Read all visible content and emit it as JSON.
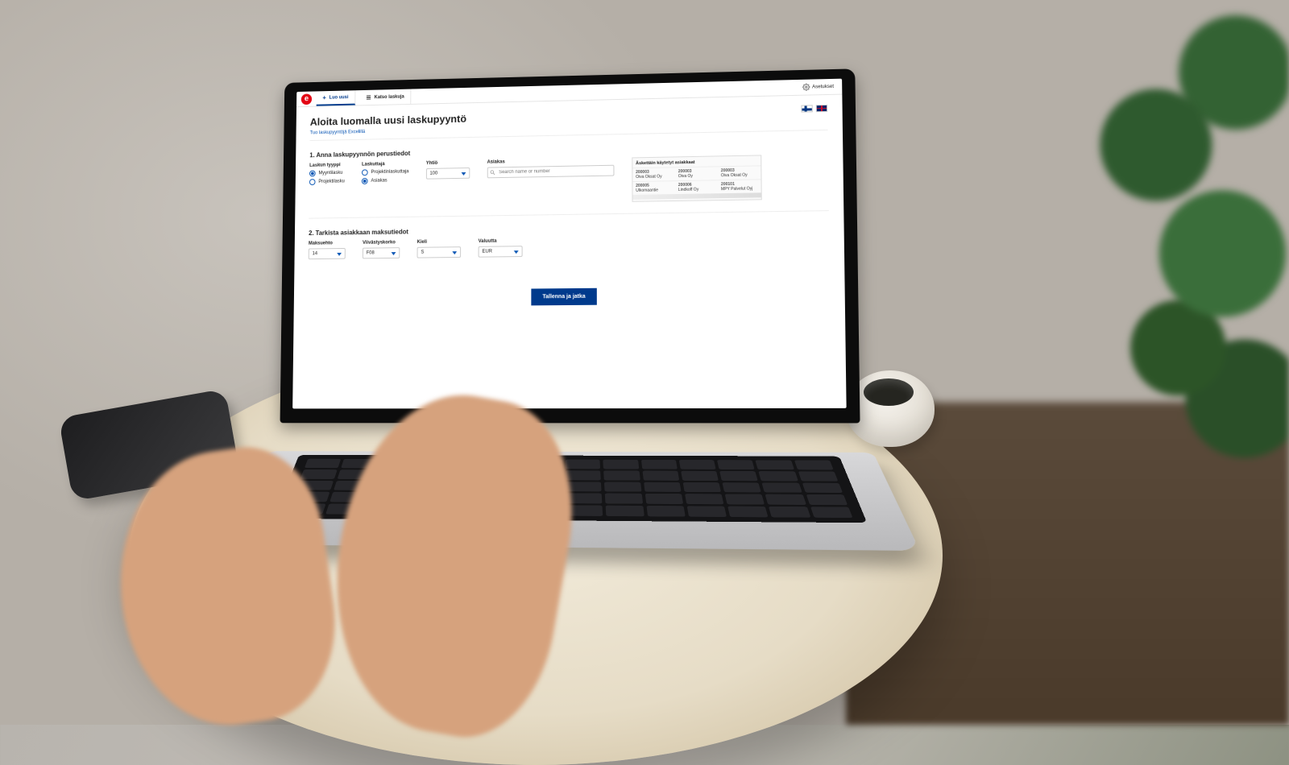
{
  "topbar": {
    "logo_letter": "e",
    "tabs": [
      {
        "icon": "+",
        "label": "Luo uusi",
        "active": true
      },
      {
        "icon": "≣",
        "label": "Katso laskuja",
        "active": false
      }
    ],
    "settings_label": "Asetukset"
  },
  "page": {
    "title": "Aloita luomalla uusi laskupyyntö",
    "subtitle_link": "Tuo laskupyyntöjä Excelillä"
  },
  "section1": {
    "title": "1. Anna laskupyynnön perustiedot",
    "invoice_type": {
      "label": "Laskun tyyppi",
      "options": [
        {
          "label": "Myyntilasku",
          "checked": true
        },
        {
          "label": "Projektilasku",
          "checked": false
        }
      ]
    },
    "invoicer": {
      "label": "Laskuttaja",
      "options": [
        {
          "label": "Projektinlaskuttaja",
          "checked": false
        },
        {
          "label": "Asiakas",
          "checked": true
        }
      ]
    },
    "company": {
      "label": "Yhtiö",
      "value": "100"
    },
    "customer": {
      "label": "Asiakas",
      "search_placeholder": "Search name or number",
      "panel_title": "Äskettäin käytetyt asiakkaat",
      "recent": [
        {
          "id": "200003",
          "name": "Oiva Oksat Oy"
        },
        {
          "id": "200003",
          "name": "Oiva Oy"
        },
        {
          "id": "200003",
          "name": "Oiva Oksat Oy"
        },
        {
          "id": "200005",
          "name": "Ulkomaantie"
        },
        {
          "id": "200006",
          "name": "Lindkoff Oy"
        },
        {
          "id": "200101",
          "name": "MPY Palvelut Oyj"
        }
      ]
    }
  },
  "section2": {
    "title": "2. Tarkista asiakkaan maksutiedot",
    "payment_terms": {
      "label": "Maksuehto",
      "value": "14"
    },
    "penalty": {
      "label": "Viivästyskorko",
      "value": "F08"
    },
    "language": {
      "label": "Kieli",
      "value": "S"
    },
    "currency": {
      "label": "Valuutta",
      "value": "EUR"
    }
  },
  "actions": {
    "save_continue": "Tallenna ja jatka"
  }
}
